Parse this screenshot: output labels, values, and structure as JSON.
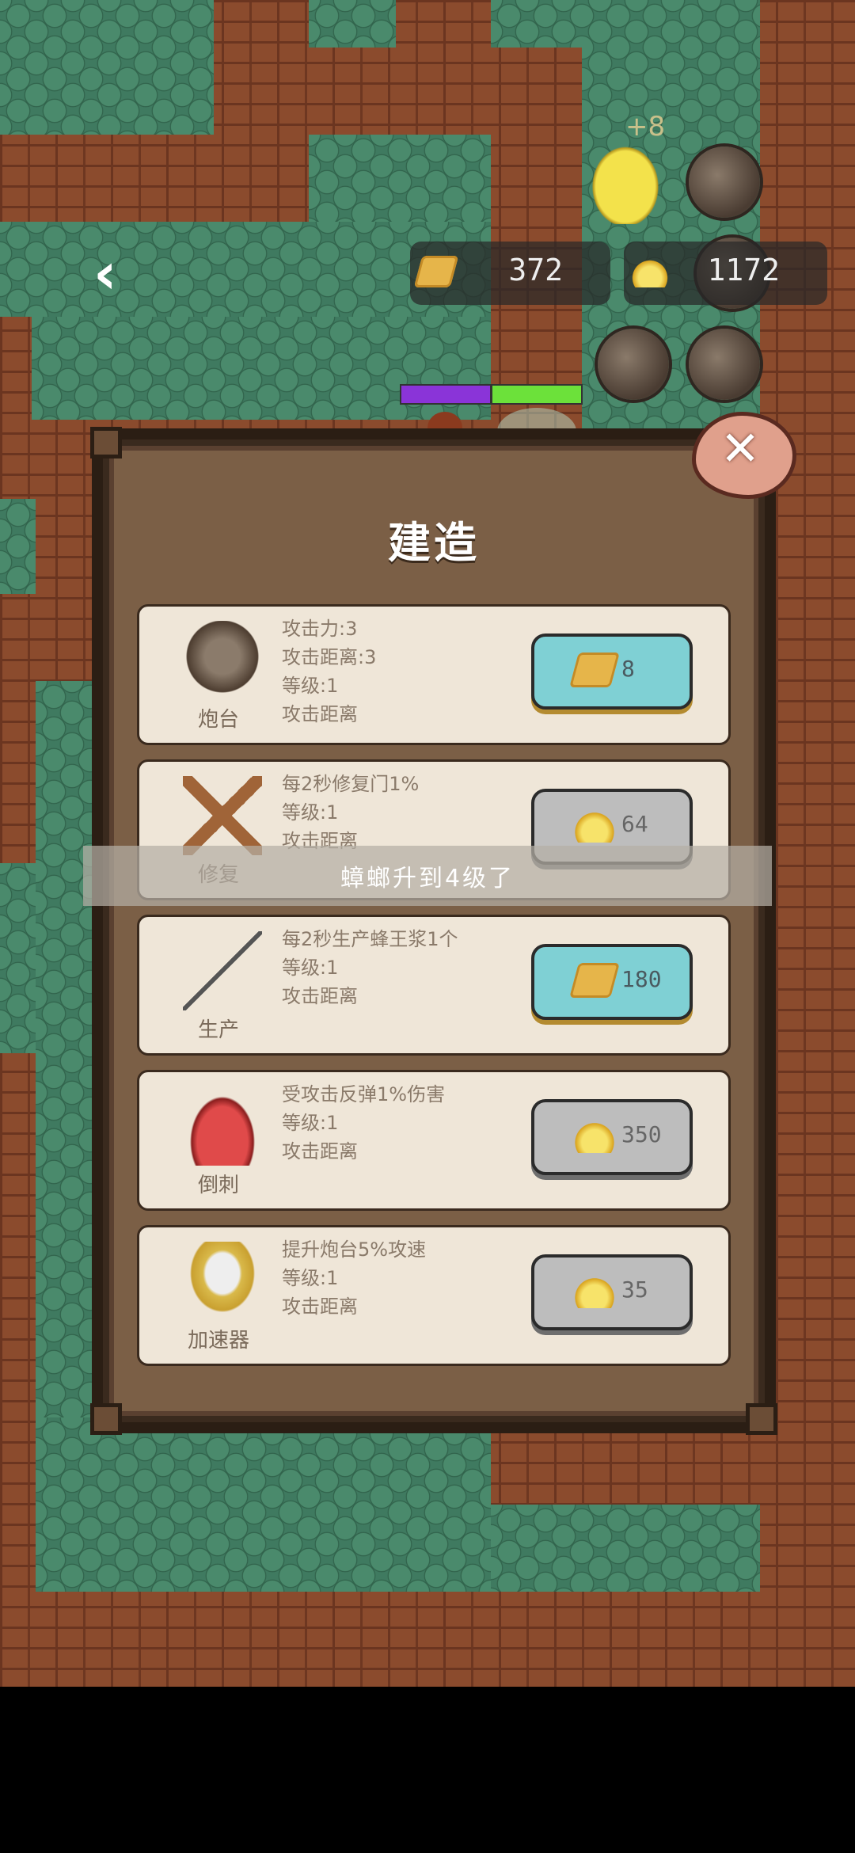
{
  "hud": {
    "back_label": "‹",
    "honey_amount": "372",
    "jelly_amount": "1172",
    "floating_gain": "+8"
  },
  "panel": {
    "title": "建造",
    "close_label": "✕",
    "items": [
      {
        "name": "炮台",
        "icon": "turret-icon",
        "lines": [
          "攻击力:3",
          "攻击距离:3",
          "等级:1",
          "攻击距离"
        ],
        "price": "8",
        "currency": "honey",
        "affordable": true
      },
      {
        "name": "修复",
        "icon": "repair-icon",
        "lines": [
          "每2秒修复门1%",
          "等级:1",
          "攻击距离"
        ],
        "price": "64",
        "currency": "jelly",
        "affordable": false
      },
      {
        "name": "生产",
        "icon": "needle-icon",
        "lines": [
          "每2秒生产蜂王浆1个",
          "等级:1",
          "攻击距离"
        ],
        "price": "180",
        "currency": "honey",
        "affordable": true
      },
      {
        "name": "倒刺",
        "icon": "spike-icon",
        "lines": [
          "受攻击反弹1%伤害",
          "等级:1",
          "攻击距离"
        ],
        "price": "350",
        "currency": "jelly",
        "affordable": false
      },
      {
        "name": "加速器",
        "icon": "accelerator-icon",
        "lines": [
          "提升炮台5%攻速",
          "等级:1",
          "攻击距离"
        ],
        "price": "35",
        "currency": "jelly",
        "affordable": false
      }
    ]
  },
  "toast": {
    "text": "蟑螂升到4级了"
  },
  "colors": {
    "panel": "#7b5f46",
    "card": "#efe6d8",
    "button_blue": "#7fd0d4",
    "button_gray": "#bdbdbd",
    "hp_purple": "#8a34d8",
    "hp_green": "#6ce13a"
  }
}
